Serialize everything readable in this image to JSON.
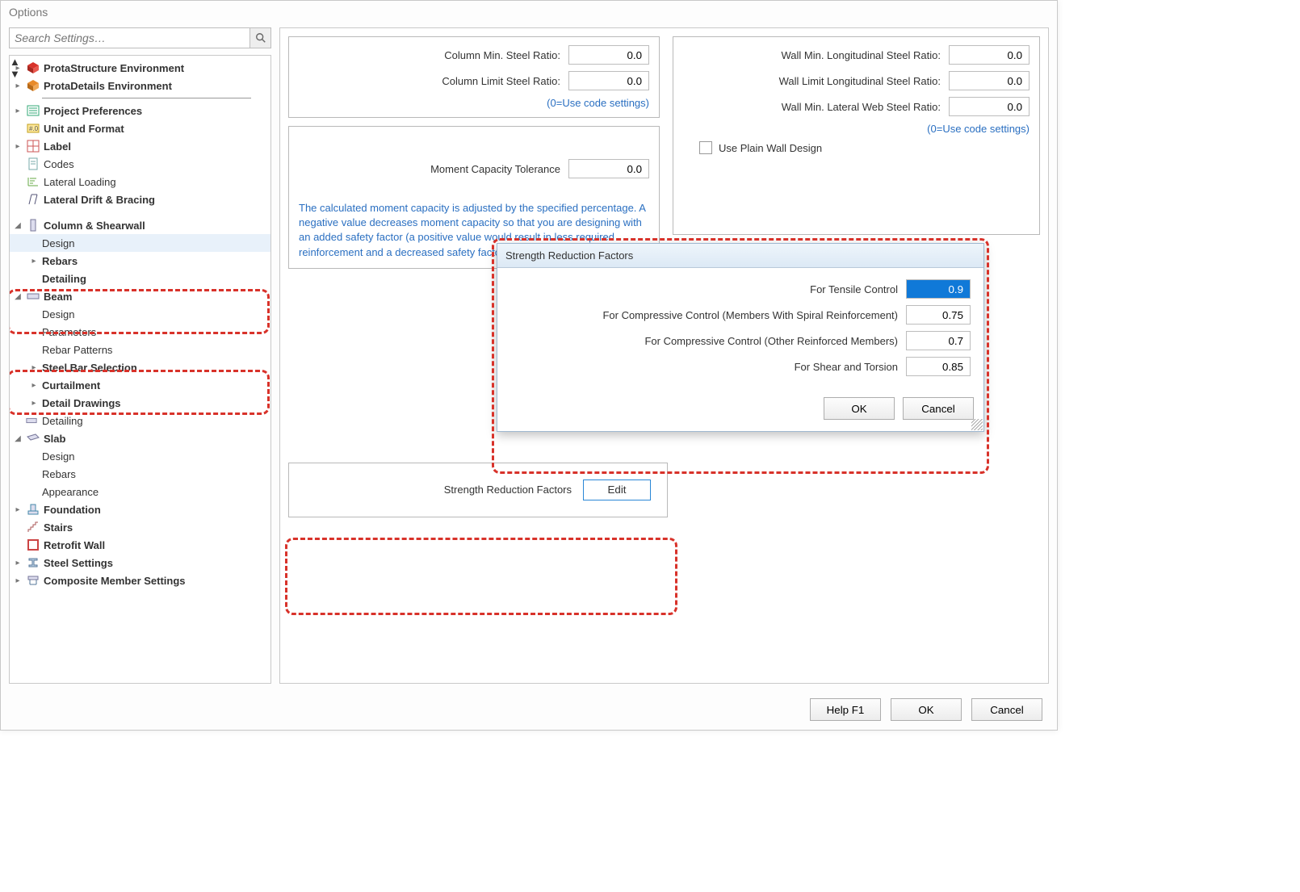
{
  "window": {
    "title": "Options"
  },
  "search": {
    "placeholder": "Search Settings…"
  },
  "tree": {
    "env1": "ProtaStructure Environment",
    "env2": "ProtaDetails Environment",
    "pp": "Project Preferences",
    "uf": "Unit and Format",
    "label": "Label",
    "codes": "Codes",
    "ll": "Lateral Loading",
    "ldb": "Lateral Drift & Bracing",
    "cs": "Column & Shearwall",
    "cs_design": "Design",
    "cs_rebars": "Rebars",
    "cs_detail": "Detailing",
    "beam": "Beam",
    "b_design": "Design",
    "b_params": "Parameters",
    "b_rp": "Rebar Patterns",
    "b_sbs": "Steel Bar Selection",
    "b_curt": "Curtailment",
    "b_dd": "Detail Drawings",
    "b_det": "Detailing",
    "slab": "Slab",
    "s_design": "Design",
    "s_rebars": "Rebars",
    "s_appear": "Appearance",
    "foundation": "Foundation",
    "stairs": "Stairs",
    "retrofit": "Retrofit Wall",
    "steel": "Steel Settings",
    "composite": "Composite Member Settings"
  },
  "col_panel": {
    "min_label": "Column Min. Steel Ratio:",
    "limit_label": "Column Limit Steel Ratio:",
    "min_val": "0.0",
    "limit_val": "0.0",
    "hint": "(0=Use code settings)"
  },
  "wall_panel": {
    "min_long_label": "Wall Min. Longitudinal Steel Ratio:",
    "lim_long_label": "Wall Limit Longitudinal Steel Ratio:",
    "min_lat_label": "Wall Min. Lateral Web Steel Ratio:",
    "min_long_val": "0.0",
    "lim_long_val": "0.0",
    "min_lat_val": "0.0",
    "hint": "(0=Use code settings)",
    "plain": "Use Plain Wall Design"
  },
  "moment_panel": {
    "label": "Moment Capacity Tolerance",
    "val": "0.0",
    "text": "The calculated moment capacity is adjusted by the specified percentage. A negative value decreases moment capacity so that you are designing with an added safety factor (a positive value would result in less required reinforcement and a decreased safety factor)."
  },
  "srf_edit": {
    "label": "Strength Reduction Factors",
    "button": "Edit"
  },
  "dialog": {
    "title": "Strength Reduction Factors",
    "r1_label": "For Tensile Control",
    "r1_val": "0.9",
    "r2_label": "For Compressive Control (Members With Spiral Reinforcement)",
    "r2_val": "0.75",
    "r3_label": "For Compressive Control (Other Reinforced Members)",
    "r3_val": "0.7",
    "r4_label": "For Shear and Torsion",
    "r4_val": "0.85",
    "ok": "OK",
    "cancel": "Cancel"
  },
  "footer": {
    "help": "Help  F1",
    "ok": "OK",
    "cancel": "Cancel"
  }
}
